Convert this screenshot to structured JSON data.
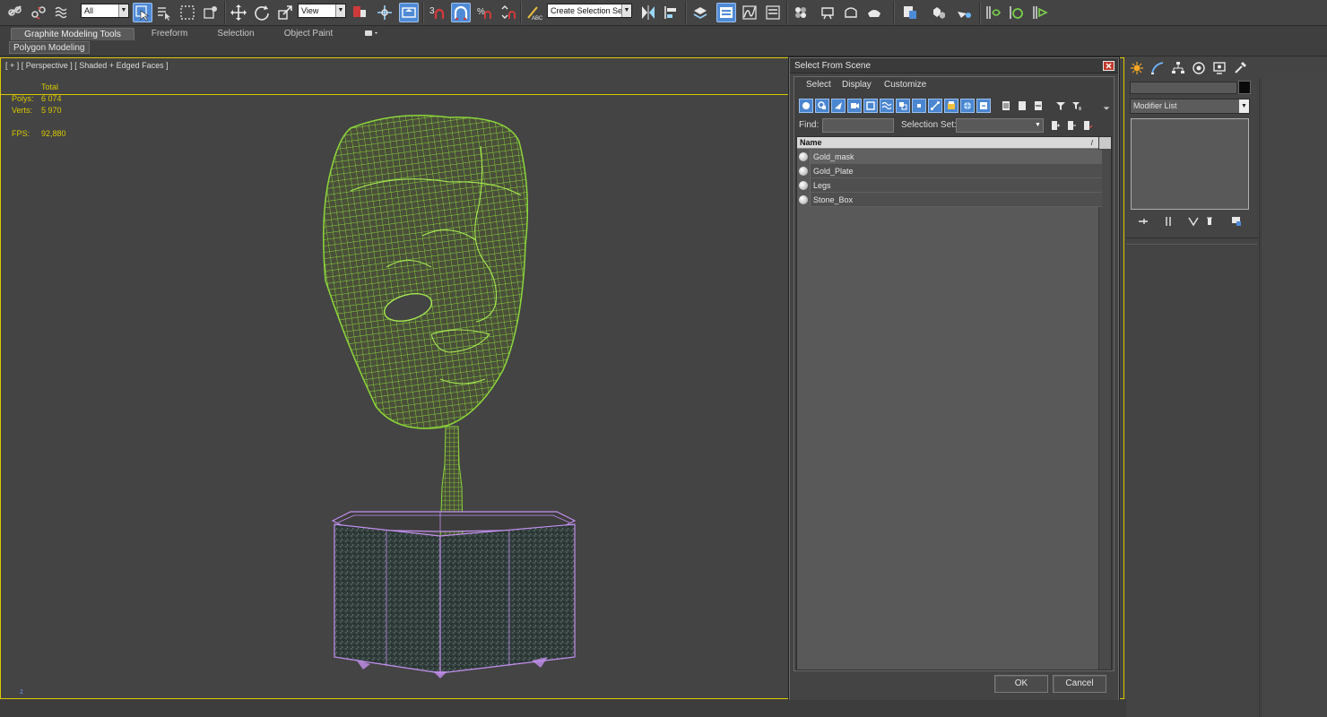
{
  "toolbar": {
    "selection_filter": "All",
    "reference_coord": "View",
    "snap_angle_label": "3",
    "named_selection_placeholder": "Create Selection Se"
  },
  "ribbon": {
    "tabs": [
      {
        "label": "Graphite Modeling Tools"
      },
      {
        "label": "Freeform"
      },
      {
        "label": "Selection"
      },
      {
        "label": "Object Paint"
      }
    ],
    "panel_tab": "Polygon Modeling"
  },
  "viewport": {
    "label": "[ + ] [ Perspective ] [ Shaded + Edged Faces ]",
    "stats": {
      "header": "Total",
      "polys_label": "Polys:",
      "polys_value": "6 074",
      "verts_label": "Verts:",
      "verts_value": "5 970",
      "fps_label": "FPS:",
      "fps_value": "92,880"
    },
    "axis_label": "z"
  },
  "dialog": {
    "title": "Select From Scene",
    "menu": [
      "Select",
      "Display",
      "Customize"
    ],
    "find_label": "Find:",
    "find_value": "",
    "selection_set_label": "Selection Set:",
    "selection_set_value": "",
    "column_header": "Name",
    "column_sort_indicator": "/",
    "objects": [
      {
        "name": "Gold_mask",
        "selected": true
      },
      {
        "name": "Gold_Plate",
        "selected": false
      },
      {
        "name": "Legs",
        "selected": false
      },
      {
        "name": "Stone_Box",
        "selected": false
      }
    ],
    "ok_label": "OK",
    "cancel_label": "Cancel"
  },
  "command_panel": {
    "object_name": "",
    "object_color": "#0a0a0a",
    "modifier_list": "Modifier List"
  },
  "colors": {
    "viewport_border": "#d9c900",
    "stats_text": "#d9c900",
    "wireframe": "#8cd63a",
    "base_wire": "#c490f0",
    "selected_tool": "#4f8ad6"
  }
}
